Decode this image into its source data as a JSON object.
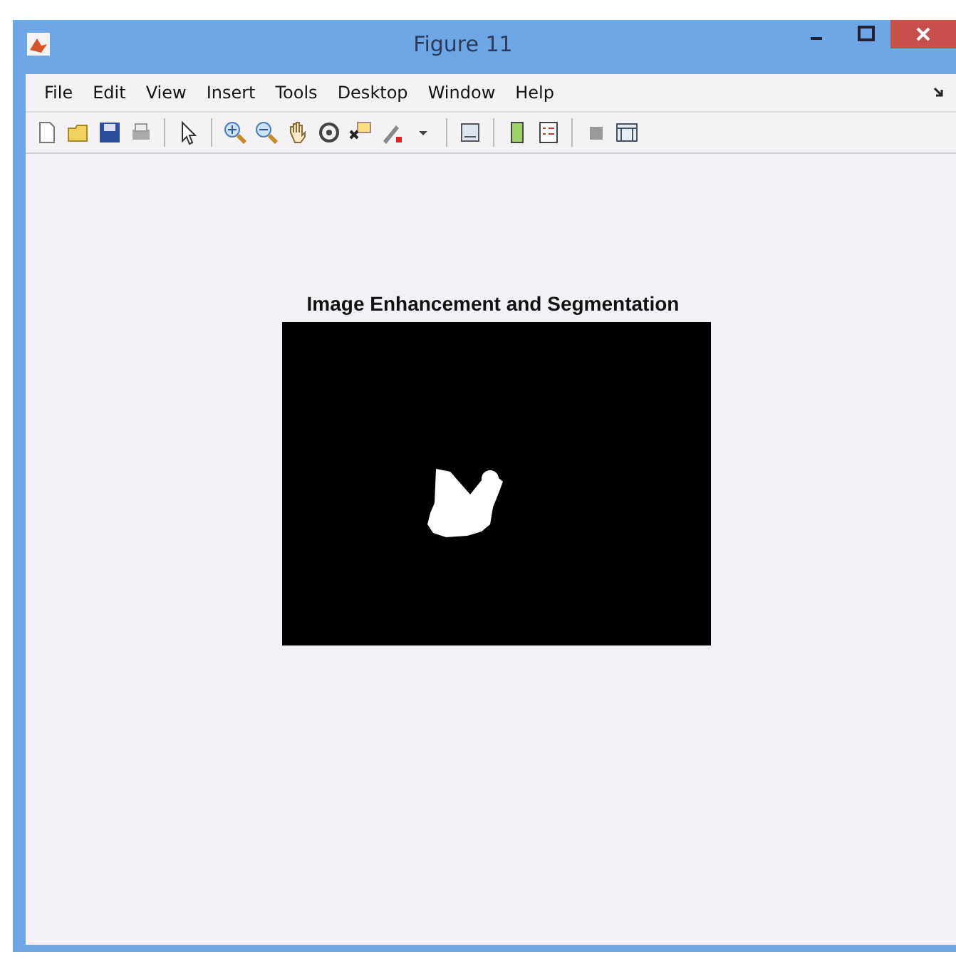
{
  "window": {
    "title": "Figure 11"
  },
  "menu": [
    "File",
    "Edit",
    "View",
    "Insert",
    "Tools",
    "Desktop",
    "Window",
    "Help"
  ],
  "axes": {
    "title": "Image Enhancement and Segmentation"
  }
}
